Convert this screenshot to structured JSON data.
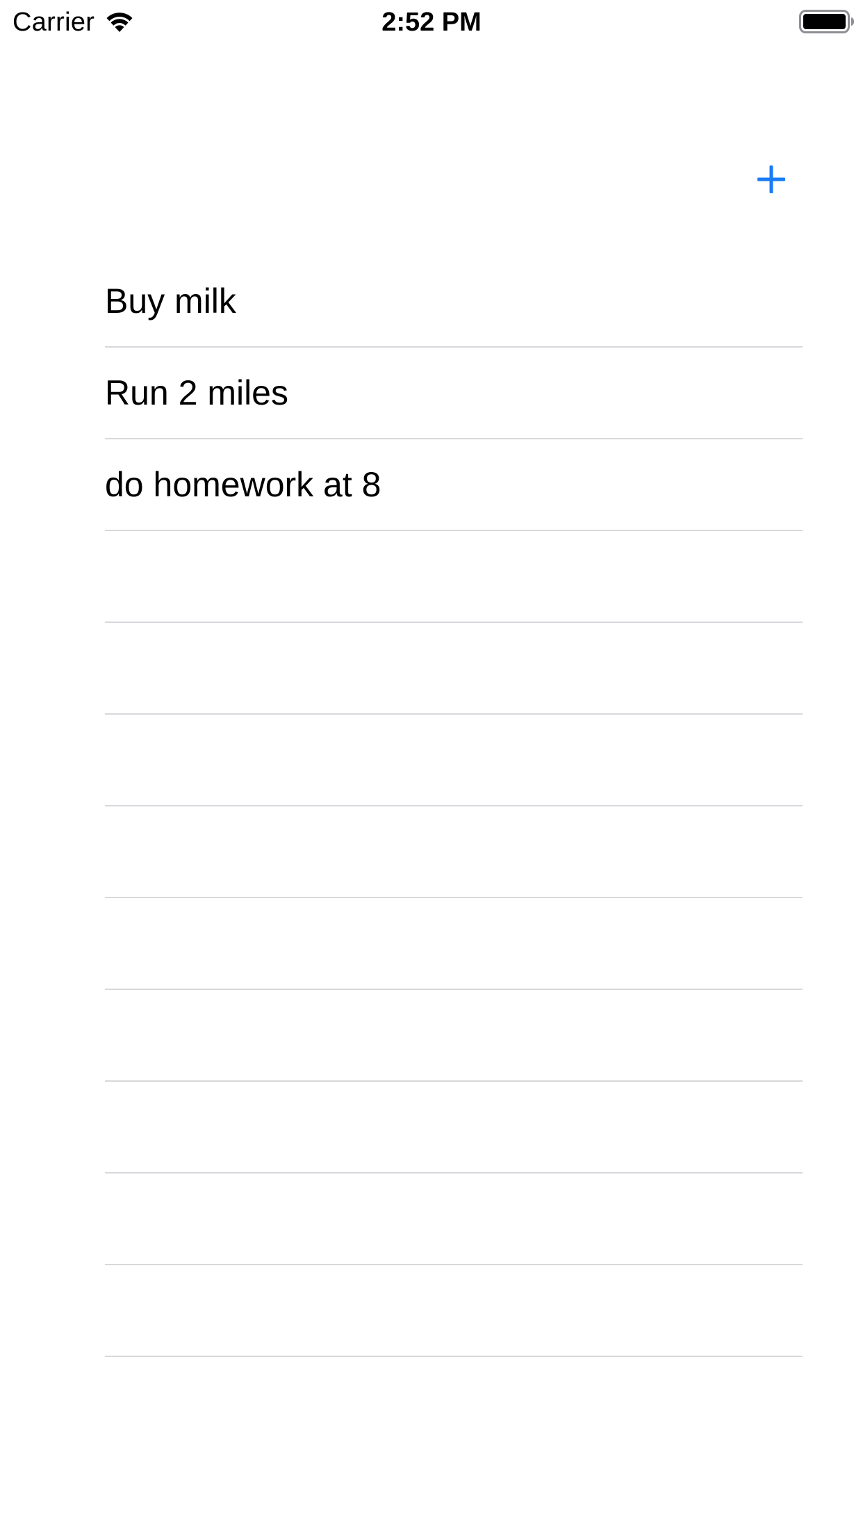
{
  "status_bar": {
    "carrier": "Carrier",
    "time": "2:52 PM",
    "wifi_icon": "wifi-icon",
    "battery_icon": "battery-icon"
  },
  "navigation": {
    "add_icon": "plus-icon",
    "accent_color": "#1a7cf5"
  },
  "tasks": [
    {
      "label": "Buy milk"
    },
    {
      "label": "Run 2 miles"
    },
    {
      "label": "do homework at 8"
    },
    {
      "label": ""
    },
    {
      "label": ""
    },
    {
      "label": ""
    },
    {
      "label": ""
    },
    {
      "label": ""
    },
    {
      "label": ""
    },
    {
      "label": ""
    },
    {
      "label": ""
    },
    {
      "label": ""
    }
  ],
  "colors": {
    "separator": "#d8d8dc",
    "text": "#000000",
    "background": "#ffffff"
  }
}
